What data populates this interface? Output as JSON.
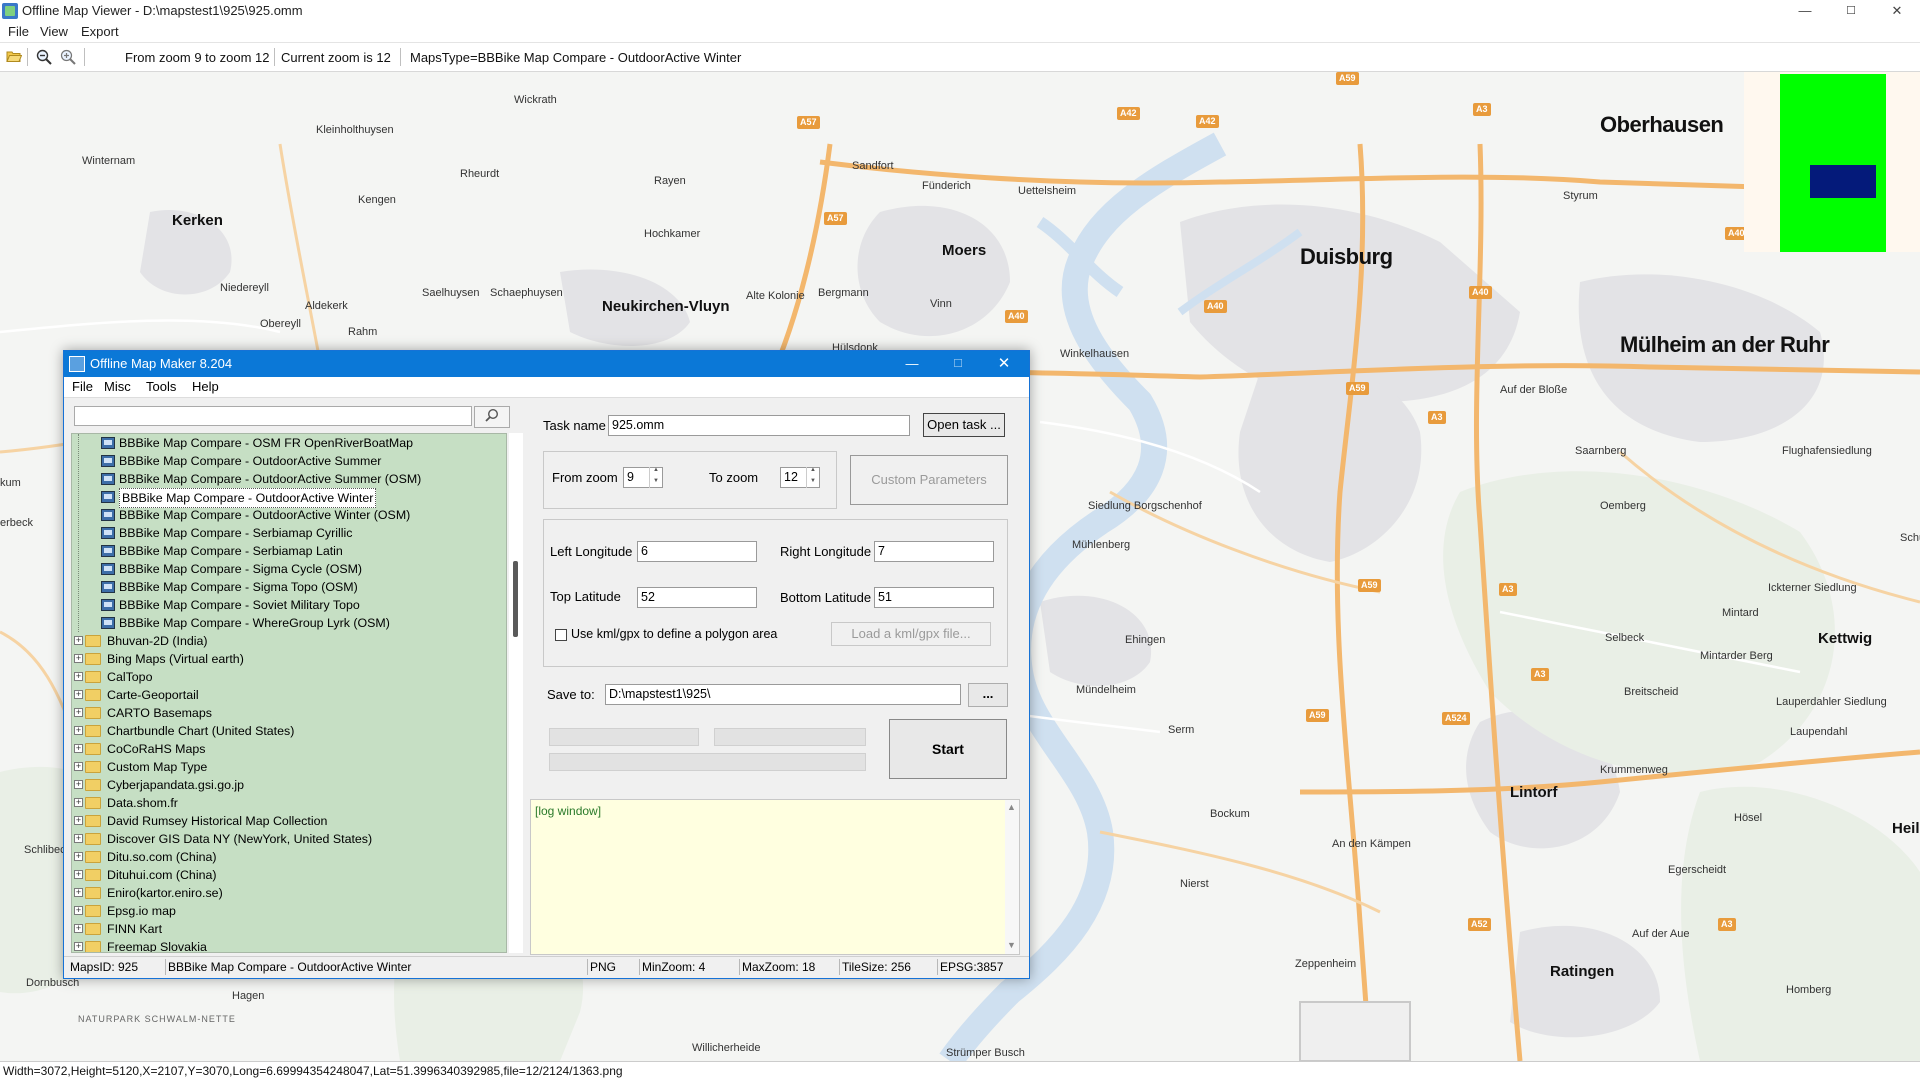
{
  "window": {
    "title": "Offline Map Viewer - D:\\mapstest1\\925\\925.omm",
    "min": "—",
    "max": "☐",
    "close": "✕"
  },
  "menu": {
    "file": "File",
    "view": "View",
    "export": "Export"
  },
  "toolbar": {
    "zoom_range": "From zoom 9 to zoom 12",
    "current_zoom": "Current zoom is 12",
    "maps_type": "MapsType=BBBike Map Compare - OutdoorActive Winter",
    "icons": [
      "open-folder-icon",
      "zoom-out-icon",
      "zoom-in-icon"
    ]
  },
  "map": {
    "places_big": [
      "Oberhausen",
      "Duisburg",
      "Mülheim an der Ruhr"
    ],
    "places_mid": [
      "Kerken",
      "Moers",
      "Neukirchen-Vluyn",
      "Lintorf",
      "Ratingen",
      "Kettwig",
      "Heilig"
    ],
    "places_small": [
      "Wickrath",
      "Kleinholthuysen",
      "Winternam",
      "Rheurdt",
      "Kengen",
      "Rayen",
      "Sandfort",
      "Fünderich",
      "Uettelsheim",
      "Hochkamer",
      "Styrum",
      "Niedereyll",
      "Aldekerk",
      "Saelhuysen",
      "Schaephuysen",
      "Alte Kolonie",
      "Bergmann",
      "Vinn",
      "Obereyll",
      "Rahm",
      "Hülsdonk",
      "Winkelhausen",
      "Auf der Bloße",
      "Saarnberg",
      "Flughafensiedlung",
      "Oemberg",
      "Siedlung Borgschenhof",
      "Mühlenberg",
      "Ickterner Siedlung",
      "Mintard",
      "Selbeck",
      "Mintarder Berg",
      "Ehingen",
      "Mündelheim",
      "Breitscheid",
      "Lauperdahler Siedlung",
      "Laupendahl",
      "Serm",
      "Krummenweg",
      "Bockum",
      "Hösel",
      "An den Kämpen",
      "Egerscheidt",
      "Nierst",
      "Auf der Aue",
      "Zeppenheim",
      "Homberg",
      "Hagen",
      "Willicherheide",
      "Strümper Busch",
      "Schlibeck",
      "Dornbusch",
      "NATURPARK SCHWALM-NETTE",
      "Schu",
      "kum",
      "erbeck"
    ],
    "shields": [
      "A59",
      "A57",
      "A42",
      "A42",
      "A3",
      "A57",
      "A40",
      "A40",
      "A40",
      "A59",
      "A3",
      "A59",
      "A3",
      "A3",
      "A59",
      "A524",
      "A52",
      "A3",
      "A40"
    ]
  },
  "minimap": {
    "frame_color": "#00ff00",
    "view_color": "#041a7a"
  },
  "statusbar": {
    "text": "Width=3072,Height=5120,X=2107,Y=3070,Long=6.69994354248047,Lat=51.3996340392985,file=12/2124/1363.png"
  },
  "dialog": {
    "title": "Offline Map Maker 8.204",
    "min": "—",
    "max": "☐",
    "close": "✕",
    "menu": {
      "file": "File",
      "misc": "Misc",
      "tools": "Tools",
      "help": "Help"
    },
    "search": {
      "value": "",
      "button_icon": "search-icon"
    },
    "tree_children": [
      "BBBike Map Compare - OSM FR OpenRiverBoatMap",
      "BBBike Map Compare - OutdoorActive Summer",
      "BBBike Map Compare - OutdoorActive Summer (OSM)",
      "BBBike Map Compare - OutdoorActive Winter",
      "BBBike Map Compare - OutdoorActive Winter (OSM)",
      "BBBike Map Compare - Serbiamap Cyrillic",
      "BBBike Map Compare - Serbiamap Latin",
      "BBBike Map Compare - Sigma Cycle (OSM)",
      "BBBike Map Compare - Sigma Topo (OSM)",
      "BBBike Map Compare - Soviet Military Topo",
      "BBBike Map Compare - WhereGroup Lyrk (OSM)"
    ],
    "tree_selected_index": 3,
    "tree_folders": [
      "Bhuvan-2D (India)",
      "Bing Maps (Virtual earth)",
      "CalTopo",
      "Carte-Geoportail",
      "CARTO Basemaps",
      "Chartbundle Chart (United States)",
      "CoCoRaHS Maps",
      "Custom Map Type",
      "Cyberjapandata.gsi.go.jp",
      "Data.shom.fr",
      "David Rumsey Historical Map Collection",
      "Discover GIS Data NY (NewYork, United States)",
      "Ditu.so.com (China)",
      "Dituhui.com (China)",
      "Eniro(kartor.eniro.se)",
      "Epsg.io map",
      "FINN Kart",
      "Freemap Slovakia"
    ],
    "form": {
      "task_name_label": "Task name",
      "task_name_value": "925.omm",
      "open_task": "Open task ...",
      "from_zoom_label": "From zoom",
      "from_zoom_value": "9",
      "to_zoom_label": "To zoom",
      "to_zoom_value": "12",
      "custom_params": "Custom Parameters",
      "left_lon_label": "Left Longitude",
      "left_lon_value": "6",
      "right_lon_label": "Right Longitude",
      "right_lon_value": "7",
      "top_lat_label": "Top Latitude",
      "top_lat_value": "52",
      "bottom_lat_label": "Bottom Latitude",
      "bottom_lat_value": "51",
      "kml_label": "Use kml/gpx to define a polygon area",
      "kml_checked": false,
      "load_kml": "Load a kml/gpx file...",
      "save_to_label": "Save to:",
      "save_to_value": "D:\\mapstest1\\925\\",
      "browse": "...",
      "start": "Start",
      "progress": [
        0,
        0,
        0
      ]
    },
    "log": "[log window]",
    "status": {
      "maps_id": "MapsID: 925",
      "maps_name": "BBBike Map Compare - OutdoorActive Winter",
      "format": "PNG",
      "min_zoom": "MinZoom: 4",
      "max_zoom": "MaxZoom: 18",
      "tile_size": "TileSize: 256",
      "epsg": "EPSG:3857"
    }
  }
}
